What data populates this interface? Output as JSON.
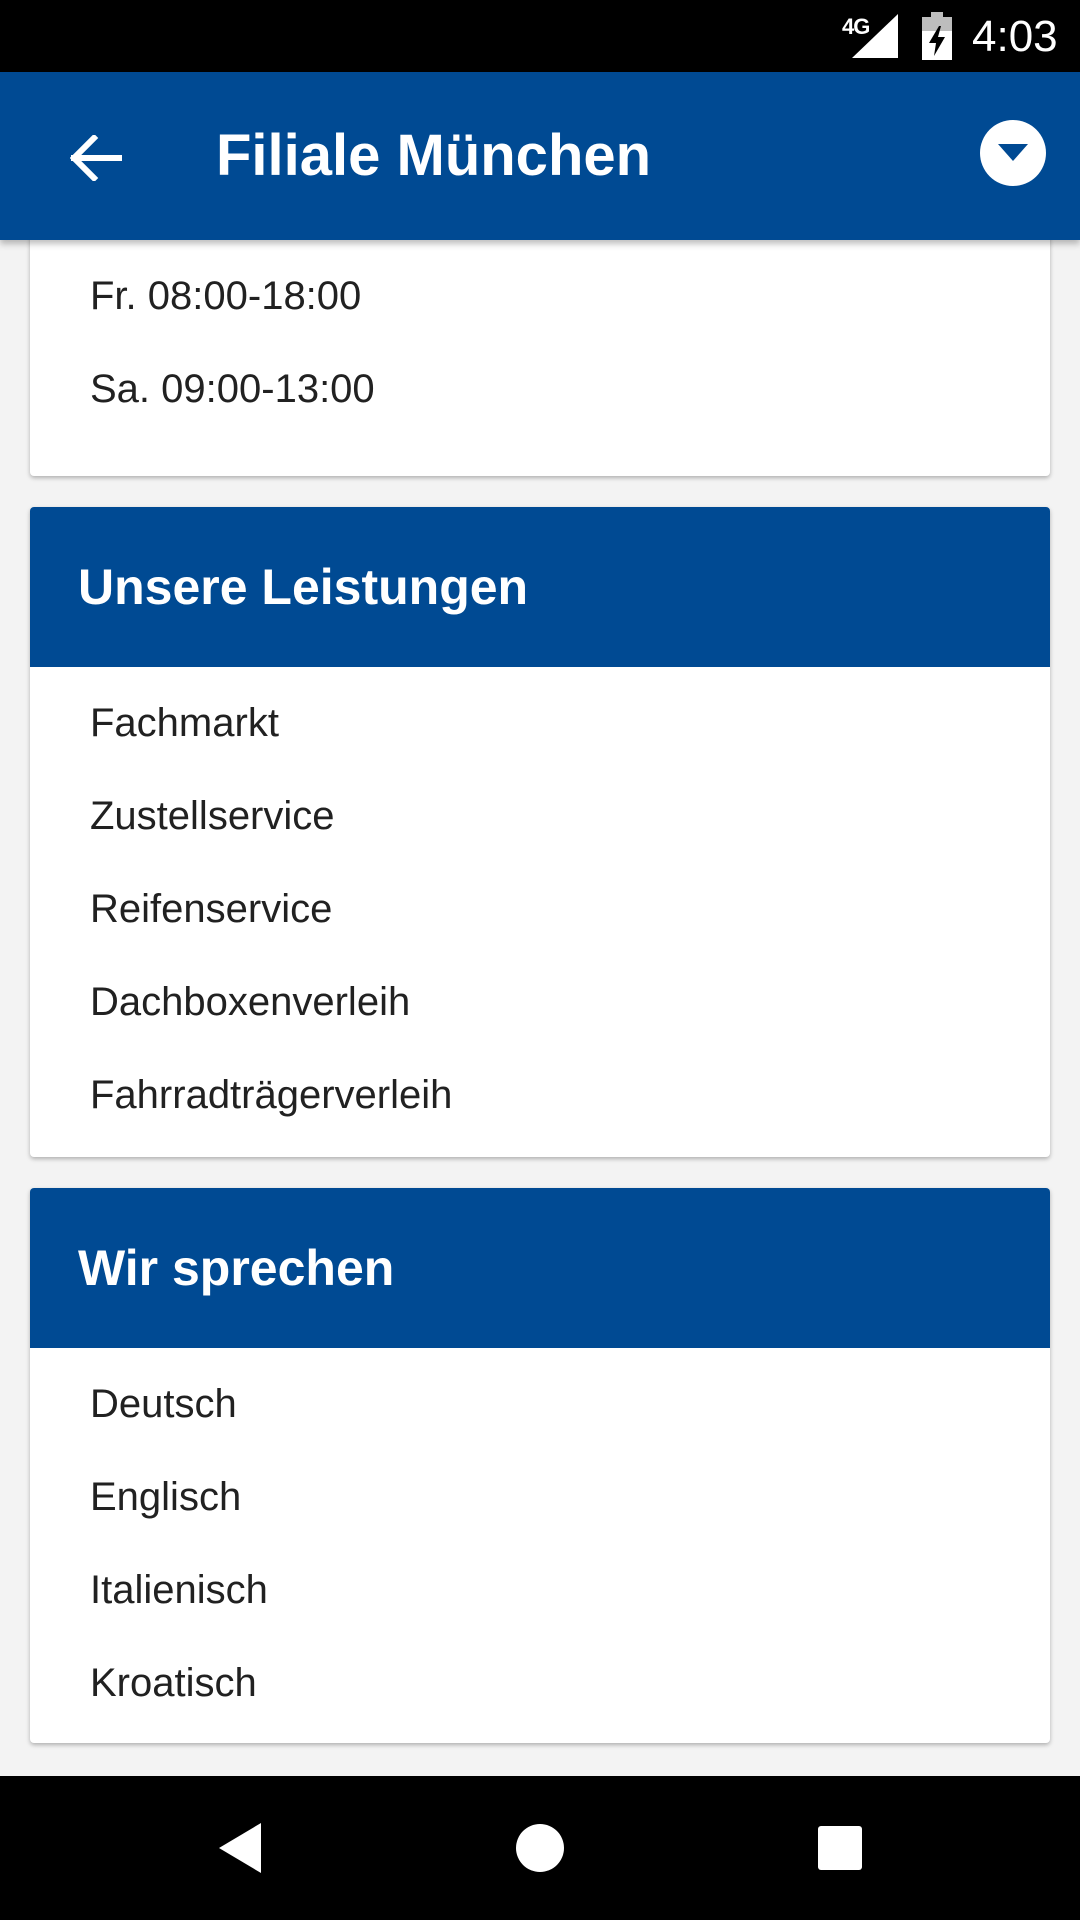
{
  "status_bar": {
    "network": "4G",
    "time": "4:03"
  },
  "app_bar": {
    "title": "Filiale München",
    "back_icon": "arrow-left-icon",
    "menu_icon": "chevron-down-circle-icon"
  },
  "hours": {
    "items": [
      "Fr. 08:00-18:00",
      "Sa. 09:00-13:00"
    ]
  },
  "services": {
    "title": "Unsere Leistungen",
    "items": [
      "Fachmarkt",
      "Zustellservice",
      "Reifenservice",
      "Dachboxenverleih",
      "Fahrradträgerverleih"
    ]
  },
  "languages": {
    "title": "Wir sprechen",
    "items": [
      "Deutsch",
      "Englisch",
      "Italienisch",
      "Kroatisch"
    ]
  },
  "nav_bar": {
    "back_icon": "triangle-back-icon",
    "home_icon": "circle-home-icon",
    "recents_icon": "square-recents-icon"
  },
  "colors": {
    "brand_blue": "#004a93",
    "background": "#f3f3f3",
    "text": "#212121"
  }
}
